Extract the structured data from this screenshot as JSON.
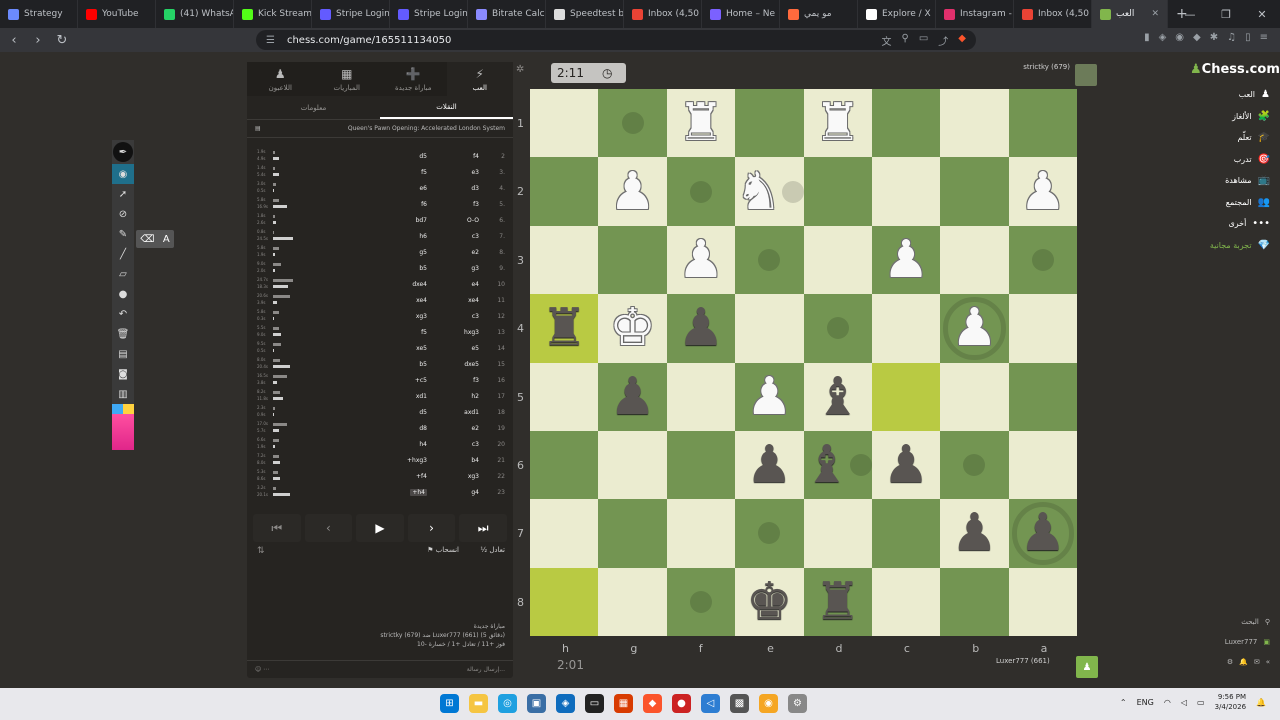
{
  "browser": {
    "tabs": [
      {
        "label": "Strategy",
        "color": "#6b8afd"
      },
      {
        "label": "YouTube",
        "color": "#ff0000"
      },
      {
        "label": "(41) WhatsApp",
        "color": "#25d366"
      },
      {
        "label": "Kick Stream",
        "color": "#53fc18"
      },
      {
        "label": "Stripe Login",
        "color": "#635bff"
      },
      {
        "label": "Stripe Login",
        "color": "#635bff"
      },
      {
        "label": "Bitrate Calc",
        "color": "#8a8aff"
      },
      {
        "label": "Speedtest b",
        "color": "#dddddd"
      },
      {
        "label": "Inbox (4,50",
        "color": "#ea4335"
      },
      {
        "label": "Home – Ne",
        "color": "#7b61ff"
      },
      {
        "label": "مو يمي",
        "color": "#ff6a3d"
      },
      {
        "label": "Explore / X",
        "color": "#ffffff"
      },
      {
        "label": "Instagram -",
        "color": "#e1306c"
      },
      {
        "label": "Inbox (4,50",
        "color": "#ea4335"
      },
      {
        "label": "العب",
        "color": "#81b64c",
        "active": true
      }
    ],
    "new_tab": "+",
    "url": "chess.com/game/165511134050"
  },
  "panel": {
    "tabs": [
      {
        "label": "العب",
        "icon": "bolt-icon",
        "glyph": "⚡",
        "active": true
      },
      {
        "label": "مباراة جديدة",
        "icon": "plus-icon",
        "glyph": "➕"
      },
      {
        "label": "المباريات",
        "icon": "games-icon",
        "glyph": "▦"
      },
      {
        "label": "اللاعبون",
        "icon": "players-icon",
        "glyph": "♟"
      }
    ],
    "sub_tabs": [
      {
        "label": "النقلات",
        "active": true
      },
      {
        "label": "معلومات"
      }
    ],
    "opening": "Queen's Pawn Opening: Accelerated London System",
    "moves": [
      {
        "n": "2",
        "w": "f4",
        "b": "d5",
        "tw": "1.9s",
        "tb": "4.9s",
        "ww": 2,
        "bw": 6
      },
      {
        "n": "3.",
        "w": "e3",
        "b": "f5",
        "tw": "1.4s",
        "tb": "5.4s",
        "ww": 2,
        "bw": 6
      },
      {
        "n": "4.",
        "w": "d3",
        "b": "e6",
        "tw": "3.0s",
        "tb": "0.5s",
        "ww": 3,
        "bw": 1
      },
      {
        "n": "5.",
        "w": "f3",
        "b": "f6",
        "tw": "5.8s",
        "tb": "16.9s",
        "ww": 6,
        "bw": 14
      },
      {
        "n": "6.",
        "w": "O-O",
        "b": "bd7",
        "tw": "1.8s",
        "tb": "2.6s",
        "ww": 2,
        "bw": 3
      },
      {
        "n": "7.",
        "w": "c3",
        "b": "h6",
        "tw": "0.8s",
        "tb": "24.5s",
        "ww": 1,
        "bw": 20
      },
      {
        "n": "8.",
        "w": "e2",
        "b": "g5",
        "tw": "5.8s",
        "tb": "1.9s",
        "ww": 6,
        "bw": 2
      },
      {
        "n": "9.",
        "w": "g3",
        "b": "b5",
        "tw": "9.0s",
        "tb": "2.0s",
        "ww": 8,
        "bw": 2
      },
      {
        "n": "10",
        "w": "e4",
        "b": "dxe4",
        "tw": "24.7s",
        "tb": "18.3s",
        "ww": 20,
        "bw": 15
      },
      {
        "n": "11",
        "w": "xe4",
        "b": "xe4",
        "tw": "20.6s",
        "tb": "3.9s",
        "ww": 17,
        "bw": 4
      },
      {
        "n": "12",
        "w": "c3",
        "b": "xg3",
        "tw": "5.8s",
        "tb": "0.3s",
        "ww": 6,
        "bw": 1
      },
      {
        "n": "13",
        "w": "hxg3",
        "b": "f5",
        "tw": "5.5s",
        "tb": "9.0s",
        "ww": 6,
        "bw": 8
      },
      {
        "n": "14",
        "w": "e5",
        "b": "xe5",
        "tw": "9.5s",
        "tb": "0.5s",
        "ww": 8,
        "bw": 1
      },
      {
        "n": "15",
        "w": "dxe5",
        "b": "b5",
        "tw": "8.0s",
        "tb": "20.4s",
        "ww": 7,
        "bw": 17
      },
      {
        "n": "16",
        "w": "f3",
        "b": "+c5",
        "tw": "16.5s",
        "tb": "3.8s",
        "ww": 14,
        "bw": 4
      },
      {
        "n": "17",
        "w": "h2",
        "b": "xd1",
        "tw": "8.2s",
        "tb": "11.8s",
        "ww": 7,
        "bw": 10
      },
      {
        "n": "18",
        "w": "axd1",
        "b": "d5",
        "tw": "2.3s",
        "tb": "0.9s",
        "ww": 2,
        "bw": 1
      },
      {
        "n": "19",
        "w": "e2",
        "b": "d8",
        "tw": "17.0s",
        "tb": "5.7s",
        "ww": 14,
        "bw": 6
      },
      {
        "n": "20",
        "w": "c3",
        "b": "h4",
        "tw": "6.6s",
        "tb": "1.9s",
        "ww": 6,
        "bw": 2
      },
      {
        "n": "21",
        "w": "b4",
        "b": "+hxg3",
        "tw": "7.2s",
        "tb": "8.0s",
        "ww": 6,
        "bw": 7
      },
      {
        "n": "22",
        "w": "xg3",
        "b": "+f4",
        "tw": "5.3s",
        "tb": "8.6s",
        "ww": 5,
        "bw": 7
      },
      {
        "n": "23",
        "w": "g4",
        "b": "+h4",
        "tw": "3.2s",
        "tb": "20.1s",
        "ww": 3,
        "bw": 17,
        "current": true
      }
    ],
    "draw_label": "تعادل",
    "resign_label": "انسحاب",
    "game_info": [
      "مباراة جديدة",
      "strictky (679) ضد Luxer777 (661) (5 دقائق)",
      "فوز +11 / تعادل +1 / خسارة -10"
    ],
    "chat_placeholder": "إرسال رسالة..."
  },
  "board": {
    "top_clock": "2:11",
    "bottom_clock": "2:01",
    "opponent": "strictky (679)",
    "player": "Luxer777 (661)",
    "ranks": [
      "1",
      "2",
      "3",
      "4",
      "5",
      "6",
      "7",
      "8"
    ],
    "files": [
      "h",
      "g",
      "f",
      "e",
      "d",
      "c",
      "b",
      "a"
    ],
    "colors": {
      "light": "#ebecd0",
      "dark": "#739552",
      "highlight_light": "#f5f682",
      "highlight_dark": "#b9ca43"
    },
    "squares": [
      [
        "",
        "",
        "wR",
        "",
        "wR",
        "",
        "",
        ""
      ],
      [
        "",
        "wP",
        "",
        "wN",
        "",
        "",
        "",
        "wP"
      ],
      [
        "",
        "",
        "wP",
        "",
        "",
        "wP",
        "",
        ""
      ],
      [
        "bR",
        "wK",
        "bP",
        "",
        "",
        "",
        "wP",
        ""
      ],
      [
        "",
        "bP",
        "",
        "wP",
        "bB",
        "",
        "",
        ""
      ],
      [
        "",
        "",
        "",
        "bP",
        "bB",
        "bP",
        "",
        ""
      ],
      [
        "",
        "",
        "",
        "",
        "",
        "",
        "bP",
        "bP"
      ],
      [
        "",
        "",
        "",
        "bK",
        "bR",
        "",
        "",
        ""
      ]
    ],
    "highlights": [
      [
        3,
        0
      ],
      [
        4,
        5
      ],
      [
        7,
        0
      ]
    ],
    "dots": [
      [
        0,
        1
      ],
      [
        1,
        2
      ],
      [
        1,
        3
      ],
      [
        2,
        3
      ],
      [
        2,
        7
      ],
      [
        3,
        4
      ],
      [
        5,
        4
      ],
      [
        5,
        6
      ],
      [
        6,
        3
      ],
      [
        7,
        2
      ]
    ],
    "rings": [
      [
        3,
        6
      ],
      [
        6,
        7
      ]
    ]
  },
  "rnav": {
    "logo": "Chess.com",
    "items": [
      {
        "label": "العب",
        "glyph": "♟"
      },
      {
        "label": "الألغاز",
        "glyph": "🧩"
      },
      {
        "label": "تعلّم",
        "glyph": "🎓"
      },
      {
        "label": "تدرب",
        "glyph": "🎯"
      },
      {
        "label": "مشاهدة",
        "glyph": "📺"
      },
      {
        "label": "المجتمع",
        "glyph": "👥"
      },
      {
        "label": "أخرى",
        "glyph": "•••"
      },
      {
        "label": "تجربة مجانية",
        "glyph": "💎",
        "free": true
      }
    ],
    "search": "البحث",
    "user": "Luxer777"
  },
  "taskbar": {
    "lang": "ENG",
    "time": "9:56 PM",
    "date": "3/4/2026"
  }
}
